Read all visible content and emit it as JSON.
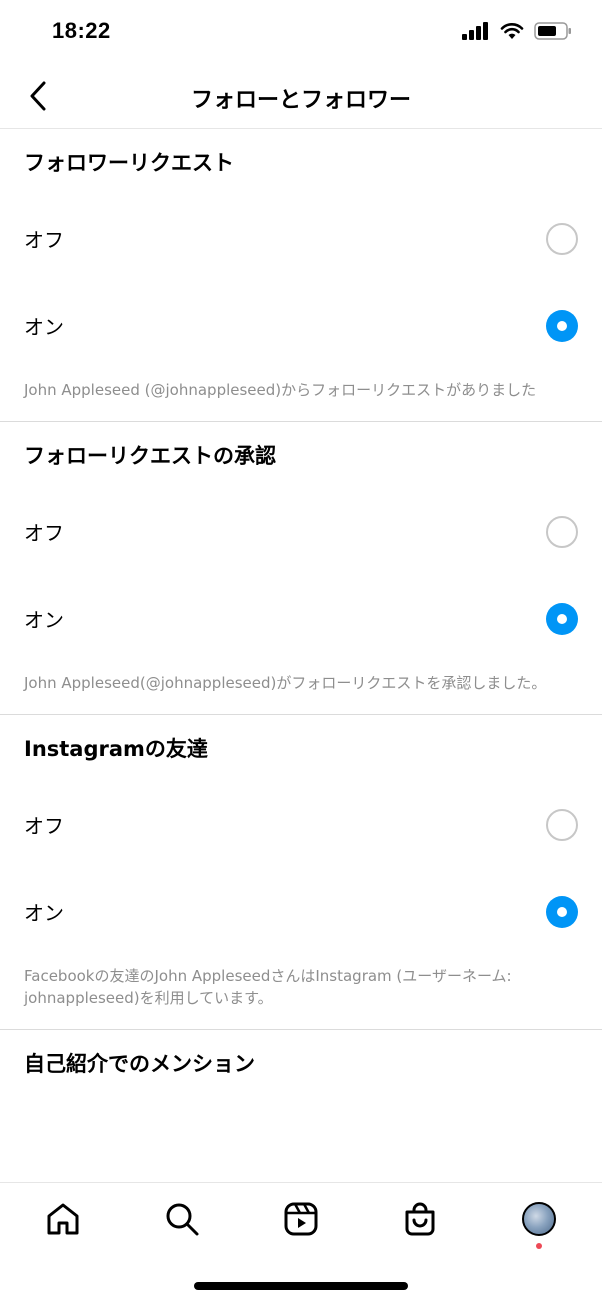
{
  "status": {
    "time": "18:22"
  },
  "header": {
    "title": "フォローとフォロワー"
  },
  "sections": [
    {
      "title": "フォロワーリクエスト",
      "options": [
        {
          "label": "オフ",
          "selected": false
        },
        {
          "label": "オン",
          "selected": true
        }
      ],
      "description": "John Appleseed (@johnappleseed)からフォローリクエストがありました"
    },
    {
      "title": "フォローリクエストの承認",
      "options": [
        {
          "label": "オフ",
          "selected": false
        },
        {
          "label": "オン",
          "selected": true
        }
      ],
      "description": "John Appleseed(@johnappleseed)がフォローリクエストを承認しました。"
    },
    {
      "title": "Instagramの友達",
      "options": [
        {
          "label": "オフ",
          "selected": false
        },
        {
          "label": "オン",
          "selected": true
        }
      ],
      "description": "Facebookの友達のJohn AppleseedさんはInstagram (ユーザーネーム: johnappleseed)を利用しています。"
    },
    {
      "title": "自己紹介でのメンション"
    }
  ],
  "tabbar": {
    "items": [
      "home-icon",
      "search-icon",
      "reels-icon",
      "shop-icon",
      "profile-avatar"
    ]
  },
  "colors": {
    "accent": "#0095f6",
    "secondary_text": "#8e8e8e",
    "notification": "#ed4956"
  }
}
